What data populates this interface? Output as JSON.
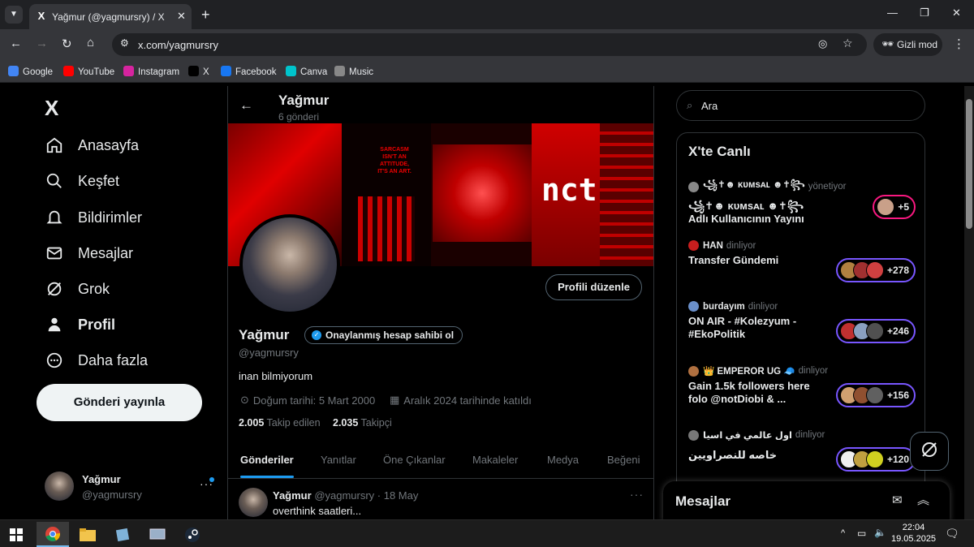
{
  "browser": {
    "tab_title": "Yağmur (@yagmursry) / X",
    "tab_icon": "X",
    "url": "x.com/yagmursry",
    "incognito_label": "Gizli mod",
    "bookmarks": [
      {
        "label": "Google",
        "color": "#4285f4"
      },
      {
        "label": "YouTube",
        "color": "#ff0000"
      },
      {
        "label": "Instagram",
        "color": "#d6249f"
      },
      {
        "label": "X",
        "color": "#000000"
      },
      {
        "label": "Facebook",
        "color": "#1877f2"
      },
      {
        "label": "Canva",
        "color": "#00c4cc"
      },
      {
        "label": "Music",
        "color": "#888888"
      }
    ]
  },
  "sidebar": {
    "logo": "X",
    "items": [
      {
        "label": "Anasayfa",
        "icon": "home-icon"
      },
      {
        "label": "Keşfet",
        "icon": "search-icon"
      },
      {
        "label": "Bildirimler",
        "icon": "bell-icon"
      },
      {
        "label": "Mesajlar",
        "icon": "mail-icon"
      },
      {
        "label": "Grok",
        "icon": "grok-icon"
      },
      {
        "label": "Profil",
        "icon": "person-icon"
      },
      {
        "label": "Daha fazla",
        "icon": "more-icon"
      }
    ],
    "post_button": "Gönderi yayınla",
    "account": {
      "name": "Yağmur",
      "handle": "@yagmursry"
    }
  },
  "profile": {
    "header_name": "Yağmur",
    "post_count": "6 gönderi",
    "banner_text": "SARCASM ISN'T AN ATTITUDE, IT'S AN ART.",
    "edit_button": "Profili düzenle",
    "name": "Yağmur",
    "verify_button": "Onaylanmış hesap sahibi ol",
    "handle": "@yagmursry",
    "bio": "inan bilmiyorum",
    "birthdate": "Doğum tarihi: 5 Mart 2000",
    "joined": "Aralık 2024 tarihinde katıldı",
    "following_count": "2.005",
    "following_label": "Takip edilen",
    "followers_count": "2.035",
    "followers_label": "Takipçi",
    "tabs": [
      "Gönderiler",
      "Yanıtlar",
      "Öne Çıkanlar",
      "Makaleler",
      "Medya",
      "Beğeni"
    ]
  },
  "post": {
    "name": "Yağmur",
    "meta": "@yagmursry · 18 May",
    "text": "overthink saatleri..."
  },
  "right": {
    "search_placeholder": "Ara",
    "live_title": "X'te Canlı",
    "spaces": [
      {
        "host": "꧁✝︎☻ ᴋᴜᴍsᴀʟ ☻✝︎꧂",
        "role": "yönetiyor",
        "title": "꧁✝︎☻ ᴋᴜᴍsᴀʟ ☻✝︎꧂ Adlı Kullanıcının Yayını",
        "count": "+5",
        "host_color": "#888888"
      },
      {
        "host": "HAN",
        "role": "dinliyor",
        "title": "Transfer Gündemi",
        "count": "+278",
        "host_color": "#c81e1e"
      },
      {
        "host": "burdayım",
        "role": "dinliyor",
        "title": "ON AIR - #Kolezyum - #EkoPolitik",
        "count": "+246",
        "host_color": "#6a8fc9"
      },
      {
        "host": "👑 EMPEROR UG 🧢",
        "role": "dinliyor",
        "title": "Gain 1.5k followers here folo @notDiobi & ...",
        "count": "+156",
        "host_color": "#b07040"
      },
      {
        "host": "اول عالمي في اسيا",
        "role": "dinliyor",
        "title": "خاصه للنصراويين",
        "count": "+120",
        "host_color": "#777777"
      }
    ],
    "messages_title": "Mesajlar"
  },
  "taskbar": {
    "time": "22:04",
    "date": "19.05.2025"
  }
}
